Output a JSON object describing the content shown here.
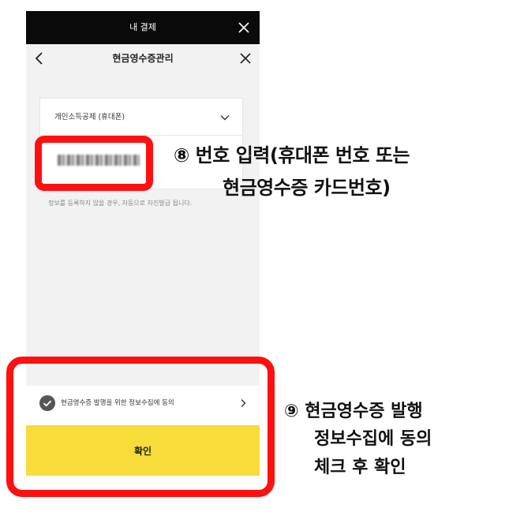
{
  "topbar": {
    "title": "내 결제"
  },
  "header": {
    "title": "현금영수증관리"
  },
  "form": {
    "select_value": "개인소득공제 (휴대폰)",
    "notice": "정보를 등록하지 않을 경우, 자동으로 자진발급 됩니다."
  },
  "consent": {
    "label": "현금영수증 발행을 위한 정보수집에 동의"
  },
  "confirm": {
    "label": "확인"
  },
  "annotations": {
    "step8_line1": "⑧ 번호 입력(휴대폰 번호 또는",
    "step8_line2": "현금영수증 카드번호)",
    "step9_line1": "⑨ 현금영수증 발행",
    "step9_line2": "정보수집에 동의",
    "step9_line3": "체크 후 확인"
  },
  "colors": {
    "accent_yellow": "#f7dc3a",
    "highlight_red": "#ff1010",
    "topbar_black": "#0a0a0a",
    "check_fill": "#555555"
  },
  "icons": [
    "close-icon",
    "back-arrow-icon",
    "chevron-down-icon",
    "check-circle-icon",
    "chevron-right-icon"
  ]
}
